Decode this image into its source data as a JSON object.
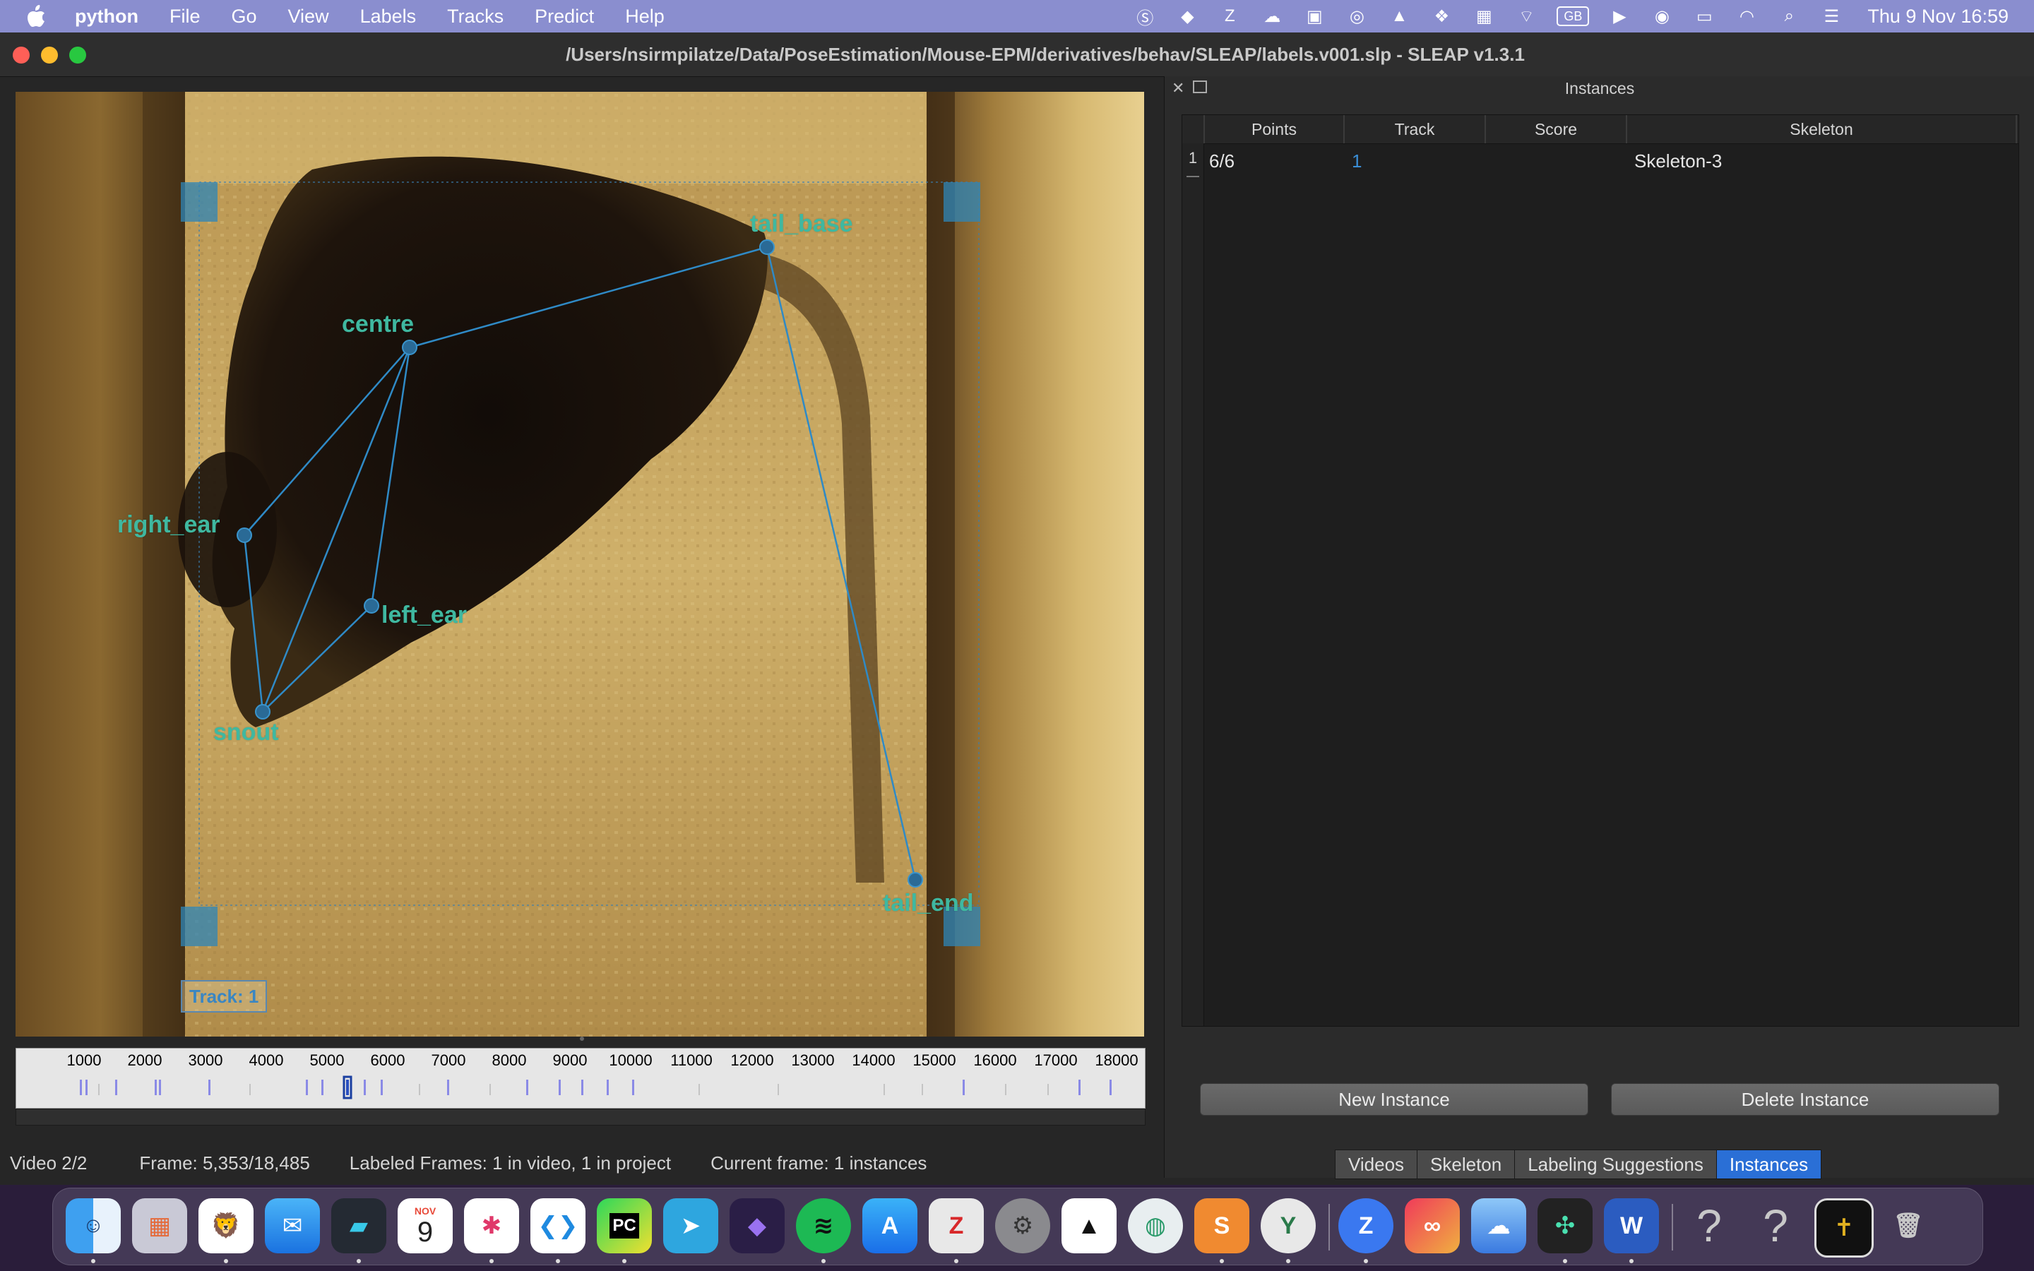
{
  "menubar": {
    "app_name": "python",
    "items": [
      "File",
      "Go",
      "View",
      "Labels",
      "Tracks",
      "Predict",
      "Help"
    ],
    "keyboard_layout": "GB",
    "clock": "Thu 9 Nov  16:59"
  },
  "window": {
    "title": "/Users/nsirmpilatze/Data/PoseEstimation/Mouse-EPM/derivatives/behav/SLEAP/labels.v001.slp - SLEAP v1.3.1"
  },
  "viewer": {
    "nodes": [
      {
        "label": "tail_base"
      },
      {
        "label": "centre"
      },
      {
        "label": "right_ear"
      },
      {
        "label": "left_ear"
      },
      {
        "label": "snout"
      },
      {
        "label": "tail_end"
      }
    ],
    "track_label": "Track: 1"
  },
  "seekbar": {
    "ticks": [
      "1000",
      "2000",
      "3000",
      "4000",
      "5000",
      "6000",
      "7000",
      "8000",
      "9000",
      "10000",
      "11000",
      "12000",
      "13000",
      "14000",
      "15000",
      "16000",
      "17000",
      "18000"
    ],
    "total_frames": 18485,
    "current_frame": 5353
  },
  "instances_panel": {
    "title": "Instances",
    "columns": [
      "Points",
      "Track",
      "Score",
      "Skeleton"
    ],
    "rows": [
      {
        "index": "1",
        "points": "6/6",
        "track": "1",
        "score": "",
        "skeleton": "Skeleton-3"
      }
    ],
    "new_button": "New Instance",
    "delete_button": "Delete Instance"
  },
  "tabs": [
    "Videos",
    "Skeleton",
    "Labeling Suggestions",
    "Instances"
  ],
  "active_tab": "Instances",
  "statusbar": {
    "video": "Video 2/2",
    "frame": "Frame: 5,353/18,485",
    "labeled": "Labeled Frames: 1 in video, 1 in project",
    "current": "Current frame: 1 instances"
  },
  "dock": {
    "calendar_month": "NOV",
    "calendar_day": "9",
    "apps": [
      "finder-icon",
      "launchpad-icon",
      "brave-icon",
      "mail-icon",
      "parallels-icon",
      "calendar-icon",
      "slack-icon",
      "vscode-icon",
      "pycharm-icon",
      "telegram-icon",
      "obsidian-icon",
      "spotify-icon",
      "app-store-icon",
      "zotero-icon",
      "system-settings-icon",
      "inkscape-icon",
      "napari-icon",
      "sublime-icon",
      "sleap-icon",
      "zoom-icon",
      "creative-cloud-icon",
      "preview-icon",
      "gitkraken-icon",
      "word-icon",
      "unknown-app-icon",
      "unknown-app-icon-2",
      "recent-app-icon",
      "trash-icon"
    ]
  }
}
